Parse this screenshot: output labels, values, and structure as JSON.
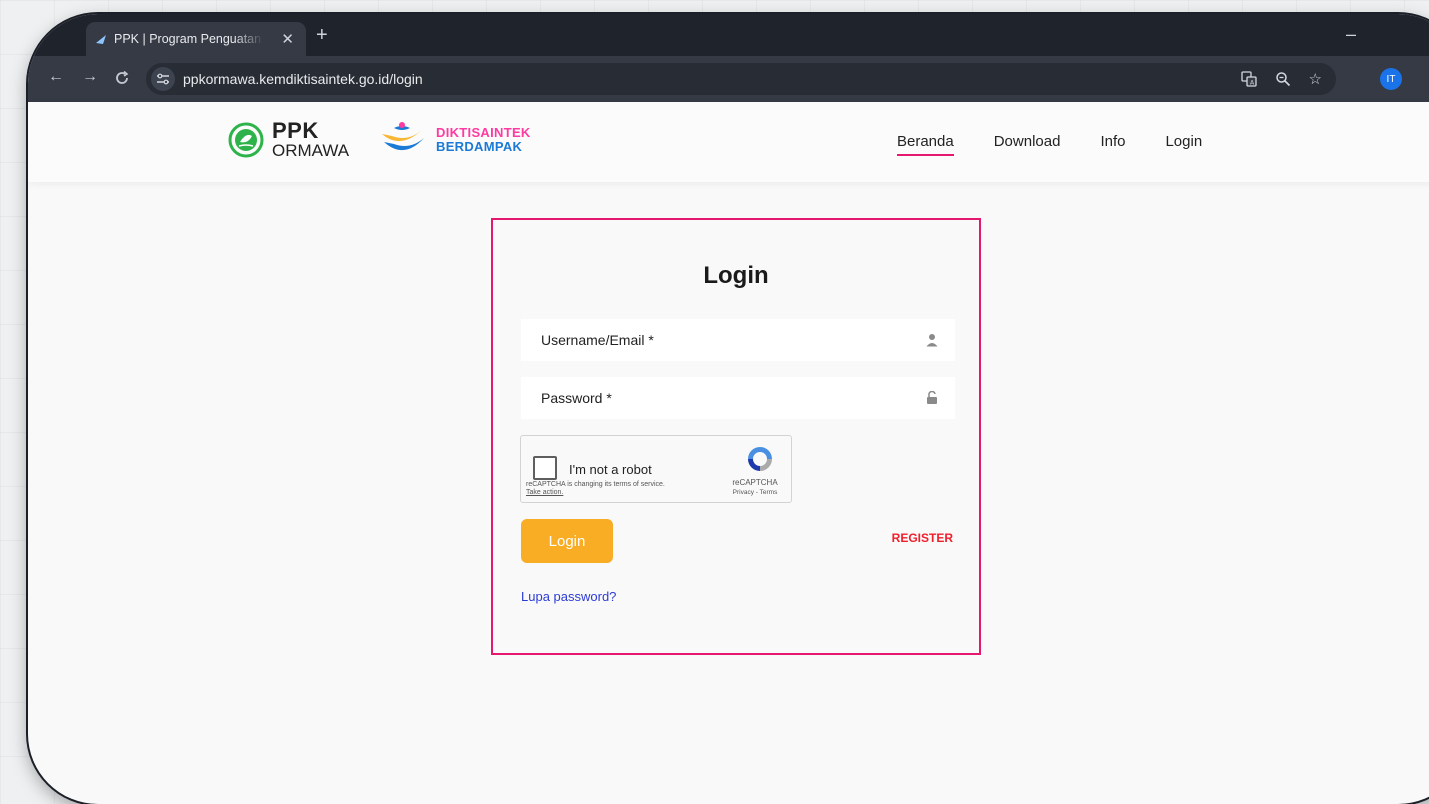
{
  "browser": {
    "tab_title": "PPK | Program Penguatan Kapasitas",
    "url": "ppkormawa.kemdiktisaintek.go.id/login",
    "profile_initials": "IT"
  },
  "header": {
    "logo_line1": "PPK",
    "logo_line2": "ORMAWA",
    "dikti_line1": "DIKTISAINTEK",
    "dikti_line2": "BERDAMPAK",
    "nav": [
      {
        "label": "Beranda",
        "active": true
      },
      {
        "label": "Download",
        "active": false
      },
      {
        "label": "Info",
        "active": false
      },
      {
        "label": "Login",
        "active": false
      }
    ]
  },
  "login": {
    "title": "Login",
    "username_placeholder": "Username/Email *",
    "password_placeholder": "Password *",
    "submit_label": "Login",
    "register_label": "REGISTER",
    "forgot_label": "Lupa password?"
  },
  "recaptcha": {
    "label": "I'm not a robot",
    "notice": "reCAPTCHA is changing its terms of service.",
    "take_action": "Take action.",
    "brand": "reCAPTCHA",
    "terms": "Privacy - Terms"
  },
  "colors": {
    "accent": "#e6176f",
    "button": "#f9ad25",
    "register": "#f01f2b",
    "link": "#2d3bd6"
  }
}
